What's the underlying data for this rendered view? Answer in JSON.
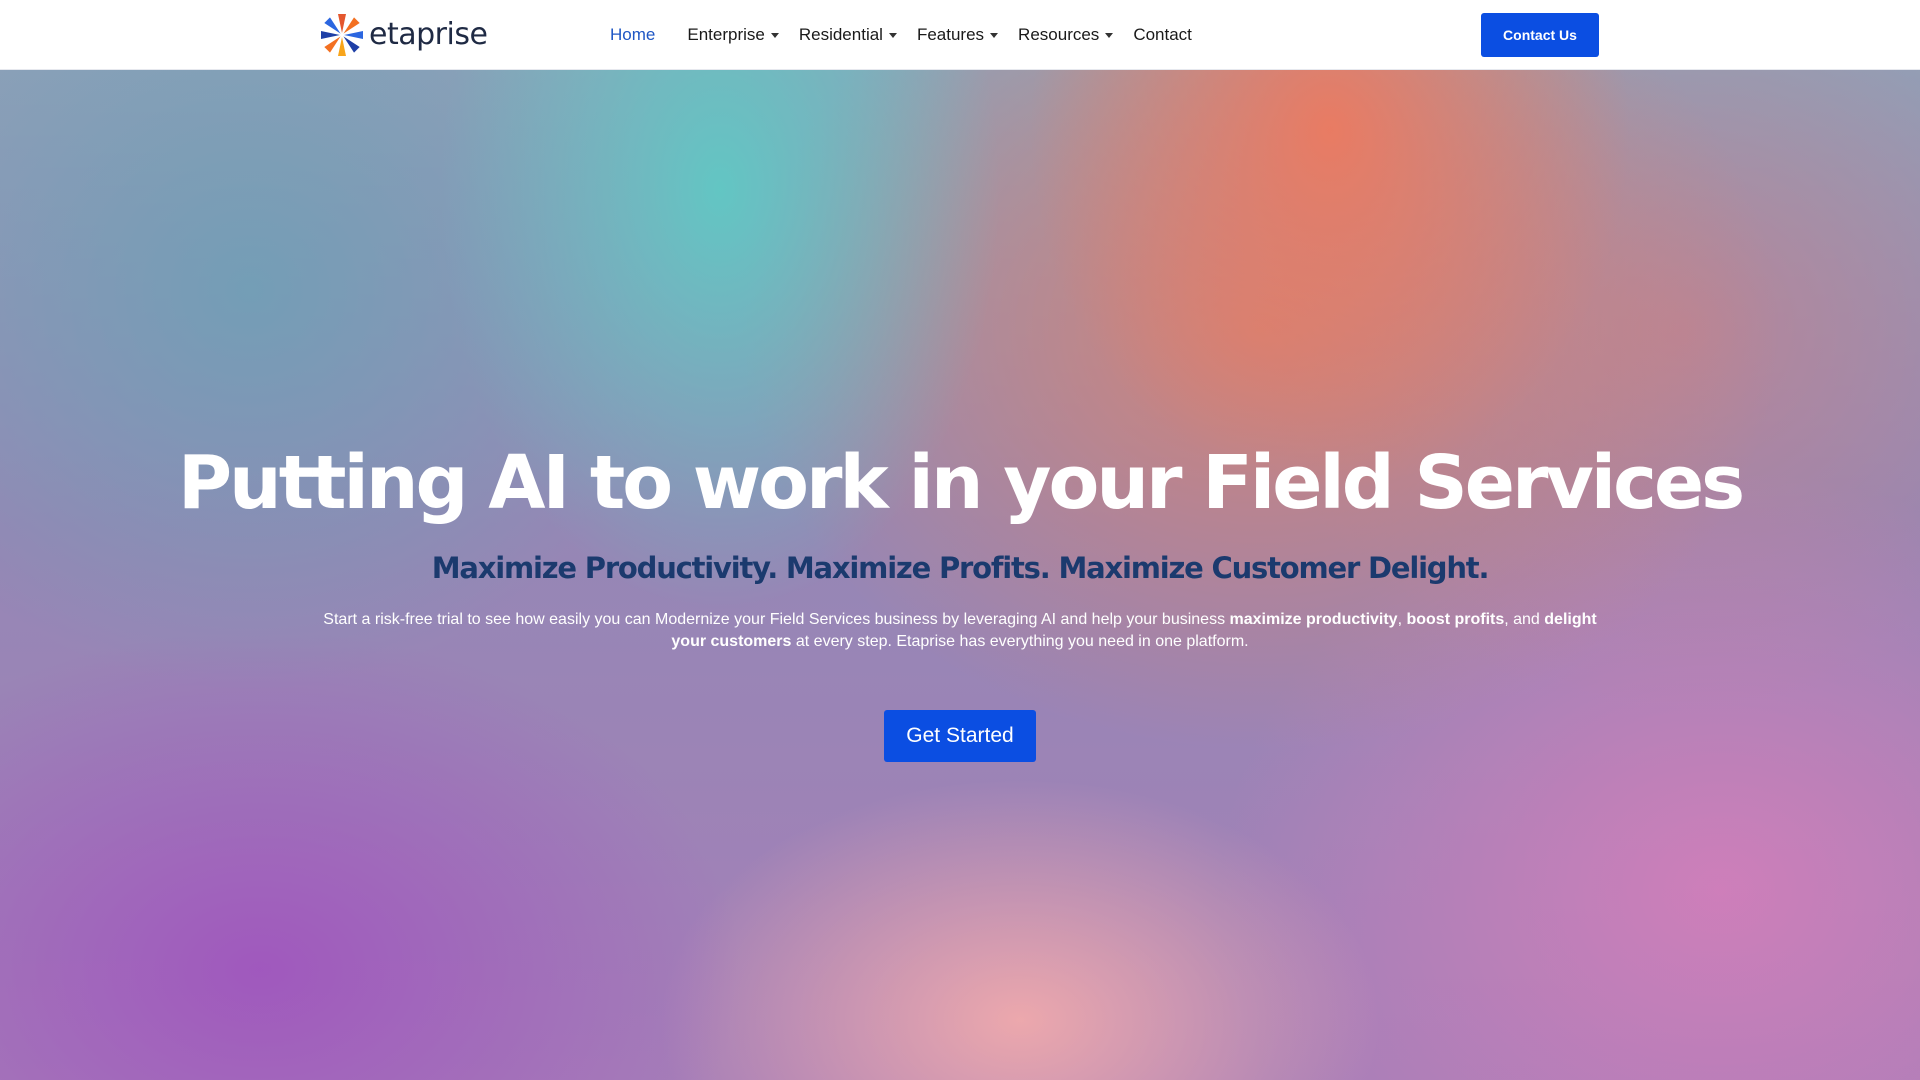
{
  "brand": {
    "name": "etaprise",
    "logo_icon": "pinwheel-logo-icon",
    "logo_colors": [
      "#f37021",
      "#1e3fa6",
      "#2b66e0",
      "#f8a51b",
      "#e4572e"
    ]
  },
  "nav": {
    "items": [
      {
        "label": "Home",
        "active": true,
        "dropdown": false
      },
      {
        "label": "Enterprise",
        "active": false,
        "dropdown": true
      },
      {
        "label": "Residential",
        "active": false,
        "dropdown": true
      },
      {
        "label": "Features",
        "active": false,
        "dropdown": true
      },
      {
        "label": "Resources",
        "active": false,
        "dropdown": true
      },
      {
        "label": "Contact",
        "active": false,
        "dropdown": false
      }
    ],
    "cta_label": "Contact Us"
  },
  "hero": {
    "title": "Putting AI to work in your Field Services",
    "subtitle": "Maximize Productivity. Maximize Profits. Maximize Customer Delight.",
    "body": {
      "intro": "Start a risk-free trial to see how easily you can Modernize your Field Services business by leveraging AI and help your business ",
      "bold1": "maximize productivity",
      "sep1": ", ",
      "bold2": "boost profits",
      "sep2": ", and ",
      "bold3": "delight your customers",
      "outro": " at every step. Etaprise has everything you need in one platform."
    },
    "cta_label": "Get Started"
  },
  "colors": {
    "accent": "#0b4ee2",
    "nav_active": "#1e56c4",
    "subtitle": "#1b3a6e"
  }
}
